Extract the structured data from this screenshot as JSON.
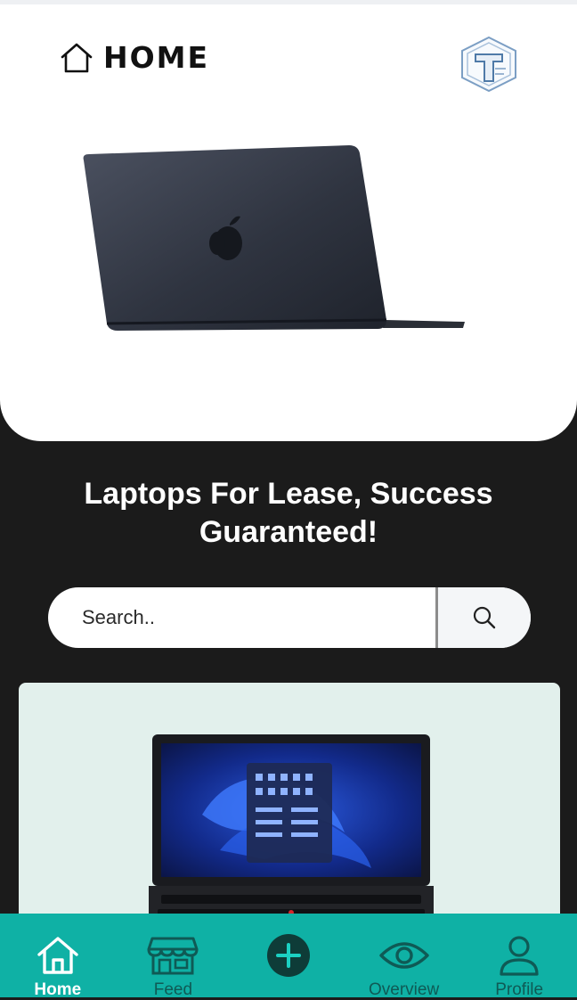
{
  "header": {
    "title": "HOME",
    "home_icon": "home-outline-icon",
    "logo": "brand-logo"
  },
  "hero": {
    "image": "macbook-laptop"
  },
  "headline": {
    "line1": "Laptops For Lease, Success",
    "line2": "Guaranteed!"
  },
  "search": {
    "placeholder": "Search..",
    "value": "",
    "icon": "search-icon"
  },
  "product_card": {
    "image": "thinkpad-laptop"
  },
  "colors": {
    "page_bg": "#1b1b1b",
    "nav_bg": "#0fb1a5",
    "card_bg": "#e2f0ec",
    "nav_inactive": "#0f5a55"
  },
  "bottom_nav": {
    "items": [
      {
        "label": "Home",
        "icon": "home-icon",
        "active": true
      },
      {
        "label": "Feed",
        "icon": "store-icon",
        "active": false
      },
      {
        "label": "",
        "icon": "add-circle-icon",
        "active": false
      },
      {
        "label": "Overview",
        "icon": "eye-icon",
        "active": false
      },
      {
        "label": "Profile",
        "icon": "user-icon",
        "active": false
      }
    ]
  }
}
